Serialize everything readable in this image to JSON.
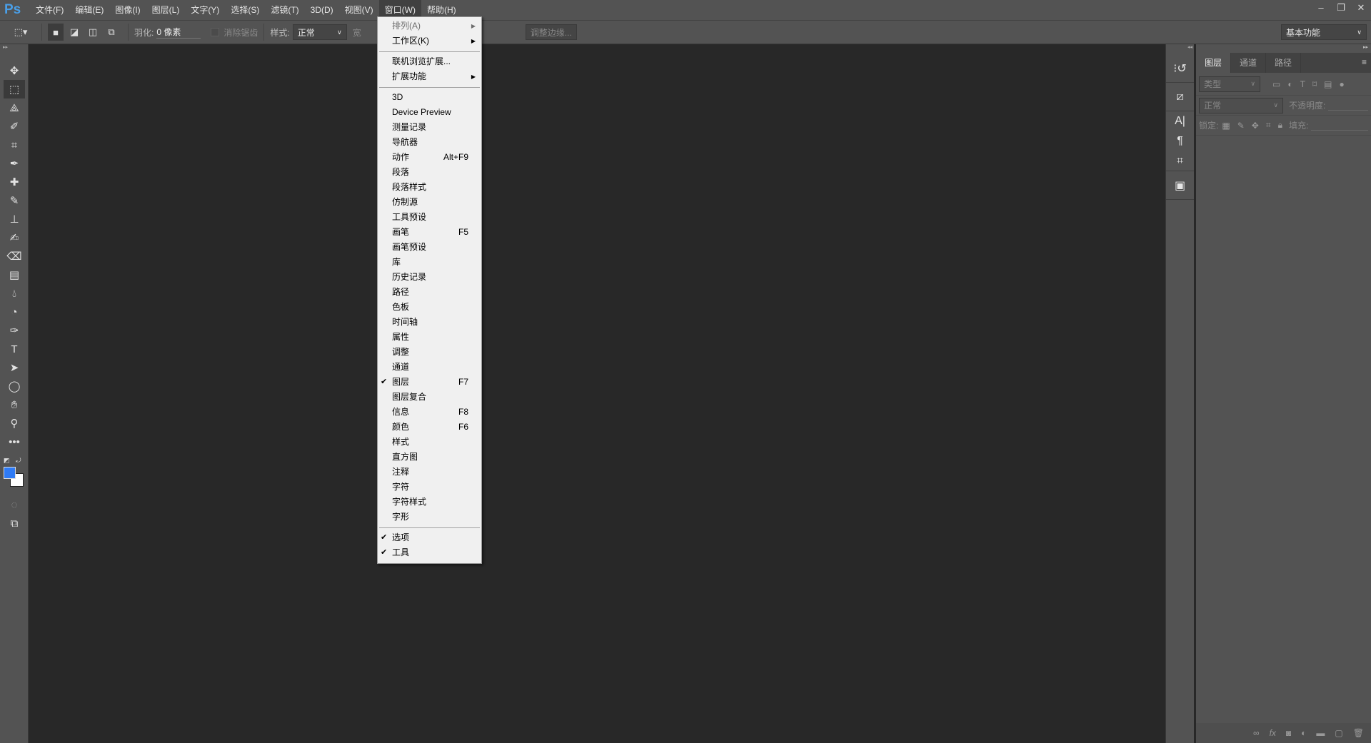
{
  "app": {
    "logo": "Ps"
  },
  "menubar": [
    "文件(F)",
    "编辑(E)",
    "图像(I)",
    "图层(L)",
    "文字(Y)",
    "选择(S)",
    "滤镜(T)",
    "3D(D)",
    "视图(V)",
    "窗口(W)",
    "帮助(H)"
  ],
  "window_controls": {
    "minimize": "–",
    "restore": "❐",
    "close": "✕"
  },
  "options": {
    "feather_label": "羽化:",
    "feather_value": "0 像素",
    "antialias_label": "消除锯齿",
    "style_label": "样式:",
    "style_value": "正常",
    "width_label": "宽",
    "refine_edge": "调整边缘...",
    "workspace": "基本功能"
  },
  "window_menu": {
    "groups": [
      [
        {
          "label": "排列(A)",
          "submenu": true,
          "disabled": true
        },
        {
          "label": "工作区(K)",
          "submenu": true
        }
      ],
      [
        {
          "label": "联机浏览扩展..."
        },
        {
          "label": "扩展功能",
          "submenu": true
        }
      ],
      [
        {
          "label": "3D"
        },
        {
          "label": "Device Preview"
        },
        {
          "label": "测量记录"
        },
        {
          "label": "导航器"
        },
        {
          "label": "动作",
          "shortcut": "Alt+F9"
        },
        {
          "label": "段落"
        },
        {
          "label": "段落样式"
        },
        {
          "label": "仿制源"
        },
        {
          "label": "工具预设"
        },
        {
          "label": "画笔",
          "shortcut": "F5"
        },
        {
          "label": "画笔预设"
        },
        {
          "label": "库"
        },
        {
          "label": "历史记录"
        },
        {
          "label": "路径"
        },
        {
          "label": "色板"
        },
        {
          "label": "时间轴"
        },
        {
          "label": "属性"
        },
        {
          "label": "调整"
        },
        {
          "label": "通道"
        },
        {
          "label": "图层",
          "shortcut": "F7",
          "checked": true
        },
        {
          "label": "图层复合"
        },
        {
          "label": "信息",
          "shortcut": "F8"
        },
        {
          "label": "颜色",
          "shortcut": "F6"
        },
        {
          "label": "样式"
        },
        {
          "label": "直方图"
        },
        {
          "label": "注释"
        },
        {
          "label": "字符"
        },
        {
          "label": "字符样式"
        },
        {
          "label": "字形"
        }
      ],
      [
        {
          "label": "选项",
          "checked": true
        },
        {
          "label": "工具",
          "checked": true
        }
      ]
    ]
  },
  "tools": [
    "move",
    "rect-marquee",
    "polygon-lasso",
    "quick-select",
    "crop",
    "eyedropper",
    "healing-brush",
    "brush",
    "clone-stamp",
    "history-brush",
    "eraser",
    "gradient",
    "blur",
    "dodge",
    "pen",
    "type",
    "path-select",
    "ellipse",
    "hand",
    "zoom",
    "more"
  ],
  "colors": {
    "foreground": "#2f7bf5",
    "background": "#ffffff"
  },
  "layers_panel": {
    "tabs": [
      "图层",
      "通道",
      "路径"
    ],
    "filter_placeholder": "类型",
    "blend_mode": "正常",
    "opacity_label": "不透明度:",
    "lock_label": "锁定:",
    "fill_label": "填充:"
  }
}
